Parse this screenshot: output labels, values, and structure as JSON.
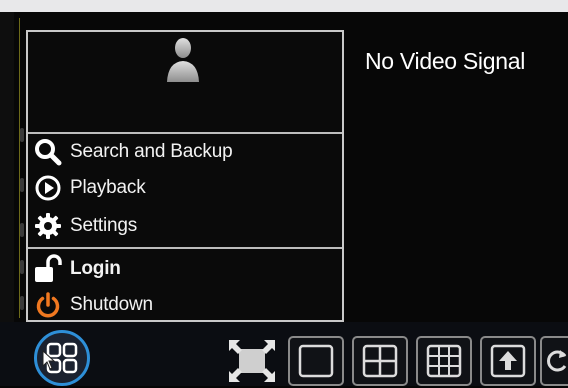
{
  "menu": {
    "items": [
      {
        "label": "Search and Backup",
        "icon": "search-icon"
      },
      {
        "label": "Playback",
        "icon": "playback-icon"
      },
      {
        "label": "Settings",
        "icon": "settings-icon"
      },
      {
        "label": "Login",
        "icon": "unlock-icon"
      },
      {
        "label": "Shutdown",
        "icon": "power-icon"
      }
    ]
  },
  "video": {
    "status": "No Video Signal"
  },
  "toolbar": {
    "buttons": [
      {
        "icon": "start-menu-icon"
      },
      {
        "icon": "fullscreen-icon"
      },
      {
        "icon": "single-view-icon"
      },
      {
        "icon": "quad-view-icon"
      },
      {
        "icon": "nine-view-icon"
      },
      {
        "icon": "upload-icon"
      },
      {
        "icon": "refresh-icon"
      }
    ]
  },
  "colors": {
    "accent": "#2e8fd8",
    "shutdown": "#f07820",
    "text": "#f2f2f2",
    "background": "#070707"
  }
}
